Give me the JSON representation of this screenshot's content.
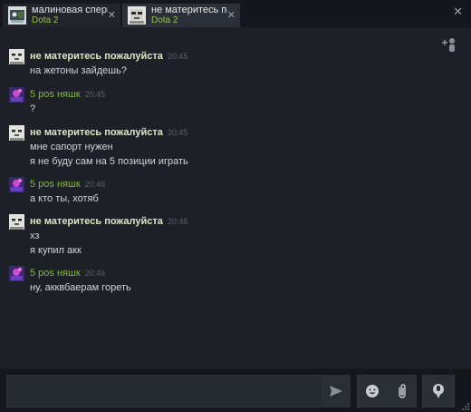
{
  "tabs": [
    {
      "name": "малиновая сперма",
      "game": "Dota 2",
      "close": "✕",
      "active": false
    },
    {
      "name": "не материтесь пож",
      "game": "Dota 2",
      "close": "✕",
      "active": true
    }
  ],
  "window": {
    "close": "✕"
  },
  "colors": {
    "self_name": "#dfe6c8",
    "other_name": "#7fb93c",
    "game_text": "#8fc04d",
    "background": "#1e2027"
  },
  "messages": [
    {
      "sender": "не материтесь пожалуйста",
      "time": "20:45",
      "lines": [
        "на жетоны зайдешь?"
      ]
    },
    {
      "sender": "5 pos няшк",
      "time": "20:45",
      "lines": [
        "?"
      ]
    },
    {
      "sender": "не материтесь пожалуйста",
      "time": "20:45",
      "lines": [
        "мне сапорт нужен",
        "я не буду сам на 5 позиции играть"
      ]
    },
    {
      "sender": "5 pos няшк",
      "time": "20:46",
      "lines": [
        "а кто ты, хотяб"
      ]
    },
    {
      "sender": "не материтесь пожалуйста",
      "time": "20:46",
      "lines": [
        "хз",
        "я купил акк"
      ]
    },
    {
      "sender": "5 pos няшк",
      "time": "20:46",
      "lines": [
        "ну, акквбаерам гореть"
      ]
    }
  ],
  "composer": {
    "value": ""
  },
  "icons": {
    "add_friend": "add-friend-icon",
    "send": "send-icon",
    "emoticon": "emoticon-icon",
    "attach": "paperclip-icon",
    "voice": "microphone-icon"
  }
}
